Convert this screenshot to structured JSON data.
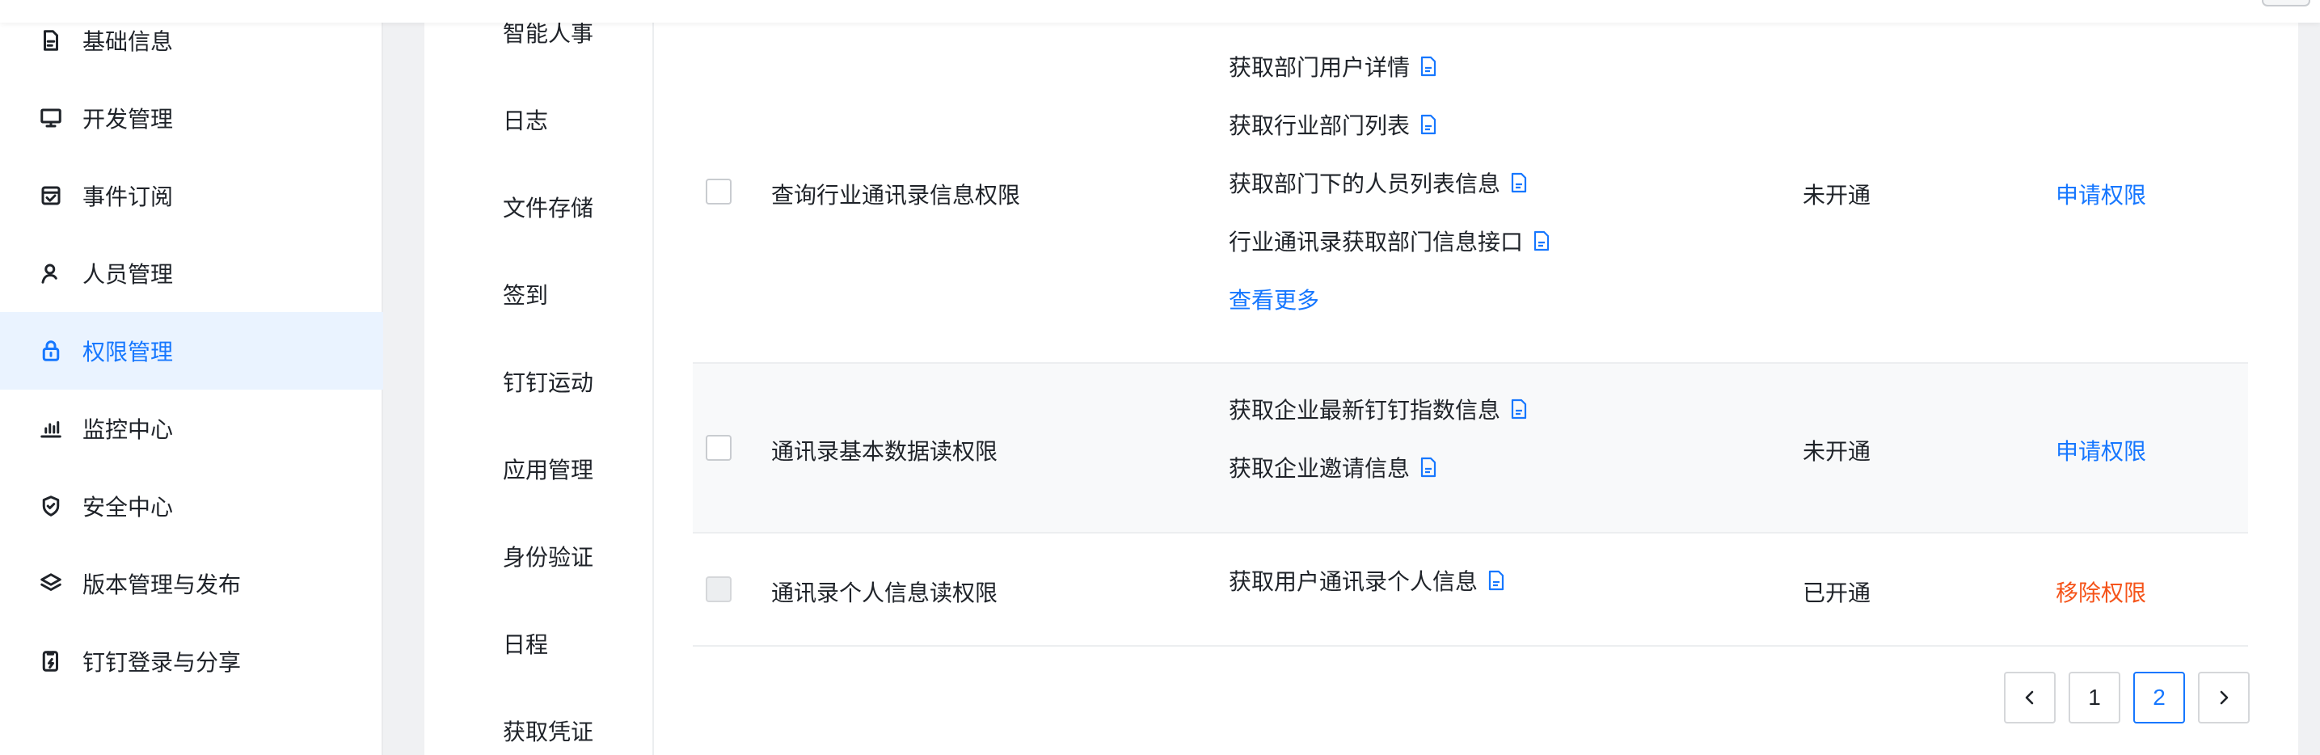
{
  "colors": {
    "accent": "#1677ff",
    "danger": "#f5541a",
    "active_bg": "#eaf3ff",
    "text": "#1f2329"
  },
  "sidebar": {
    "items": [
      {
        "label": "基础信息",
        "icon": "document-icon"
      },
      {
        "label": "开发管理",
        "icon": "monitor-icon"
      },
      {
        "label": "事件订阅",
        "icon": "calendar-check-icon"
      },
      {
        "label": "人员管理",
        "icon": "user-icon"
      },
      {
        "label": "权限管理",
        "icon": "lock-icon",
        "active": true
      },
      {
        "label": "监控中心",
        "icon": "bar-chart-icon"
      },
      {
        "label": "安全中心",
        "icon": "shield-icon"
      },
      {
        "label": "版本管理与发布",
        "icon": "layers-icon"
      },
      {
        "label": "钉钉登录与分享",
        "icon": "phone-share-icon"
      }
    ]
  },
  "categories": [
    "智能人事",
    "日志",
    "文件存储",
    "签到",
    "钉钉运动",
    "应用管理",
    "身份验证",
    "日程",
    "获取凭证"
  ],
  "table": {
    "rows": [
      {
        "name": "查询行业通讯录信息权限",
        "apis": [
          "获取部门用户详情",
          "获取行业部门列表",
          "获取部门下的人员列表信息",
          "行业通讯录获取部门信息接口"
        ],
        "more": "查看更多",
        "status": "未开通",
        "action": "申请权限"
      },
      {
        "name": "通讯录基本数据读权限",
        "apis": [
          "获取企业最新钉钉指数信息",
          "获取企业邀请信息"
        ],
        "status": "未开通",
        "action": "申请权限"
      },
      {
        "name": "通讯录个人信息读权限",
        "apis": [
          "获取用户通讯录个人信息"
        ],
        "status": "已开通",
        "action": "移除权限"
      }
    ]
  },
  "pagination": {
    "pages": [
      "1",
      "2"
    ],
    "current": "2"
  }
}
